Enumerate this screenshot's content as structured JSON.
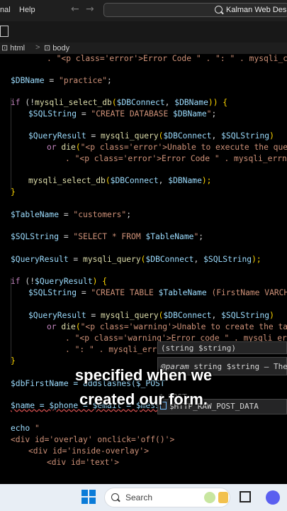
{
  "menubar": {
    "item_nal": "nal",
    "item_help": "Help",
    "back_icon": "arrow-left",
    "forward_icon": "arrow-right"
  },
  "search": {
    "text": "Kalman Web Design",
    "icon": "search-icon"
  },
  "breadcrumb": {
    "item1": "html",
    "item2": "body",
    "separator": ">"
  },
  "code": {
    "l01": ". \"<p class='error'>Error Code \" . \": \" . mysqli_conn",
    "l02a": "$DBName",
    "l02b": " = ",
    "l02c": "\"practice\"",
    "l02d": ";",
    "l03a": "if",
    "l03b": " (!",
    "l03c": "mysqli_select_db",
    "l03d": "(",
    "l03e": "$DBConnect",
    "l03f": ", ",
    "l03g": "$DBName",
    "l03h": ")) {",
    "l04a": "$SQLString",
    "l04b": " = ",
    "l04c": "\"CREATE DATABASE ",
    "l04d": "$DBName",
    "l04e": "\"",
    "l04f": ";",
    "l05a": "$QueryResult",
    "l05b": " = ",
    "l05c": "mysqli_query",
    "l05d": "(",
    "l05e": "$DBConnect",
    "l05f": ", ",
    "l05g": "$SQLString",
    "l05h": ")",
    "l06a": "or ",
    "l06b": "die",
    "l06c": "(",
    "l06d": "\"<p class='error'>Unable to execute the query.",
    "l07": ". \"<p class='error'>Error Code \" . mysqli_errno($",
    "l08a": "mysqli_select_db",
    "l08b": "(",
    "l08c": "$DBConnect",
    "l08d": ", ",
    "l08e": "$DBName",
    "l08f": ");",
    "l09": "}",
    "l10a": "$TableName",
    "l10b": " = ",
    "l10c": "\"customers\"",
    "l10d": ";",
    "l11a": "$SQLString",
    "l11b": " = ",
    "l11c": "\"SELECT * FROM ",
    "l11d": "$TableName",
    "l11e": "\"",
    "l11f": ";",
    "l12a": "$QueryResult",
    "l12b": " = ",
    "l12c": "mysqli_query",
    "l12d": "(",
    "l12e": "$DBConnect",
    "l12f": ", ",
    "l12g": "$SQLString",
    "l12h": ");",
    "l13a": "if",
    "l13b": " (!",
    "l13c": "$QueryResult",
    "l13d": ") {",
    "l14a": "$SQLString",
    "l14b": " = ",
    "l14c": "\"CREATE TABLE ",
    "l14d": "$TableName",
    "l14e": " (FirstName VARCHAR(",
    "l15a": "$QueryResult",
    "l15b": " = ",
    "l15c": "mysqli_query",
    "l15d": "(",
    "l15e": "$DBConnect",
    "l15f": ", ",
    "l15g": "$SQLString",
    "l15h": ")",
    "l16a": "or ",
    "l16b": "die",
    "l16c": "(",
    "l16d": "\"<p class='warning'>Unable to create the table",
    "l17": ". \"<p class='warning'>Error code \" . mysqli_errno(",
    "l18": ". \": \" . mysqli_erro",
    "l19": "}",
    "l20": "$dbFirstName = addslashes($_POST",
    "l21": "$name = $phone = $email = $messa",
    "l22a": "echo",
    "l22b": " \"",
    "l23a": "<div id='overlay' onclick='off()'>",
    "l24a": "<div id='inside-overlay'>",
    "l25a": "<div id='text'>"
  },
  "tooltip": {
    "sig": "(string $string)",
    "param_label": "@param",
    "param_type": " string ",
    "param_var": "$string",
    "param_rest": " — The"
  },
  "suggestion": {
    "icon": "variable-icon",
    "text": "$HTTP_RAW_POST_DATA",
    "faded": "$_POST"
  },
  "caption": {
    "line1": "specified when we",
    "line2": "created our form."
  },
  "taskbar": {
    "search_placeholder": "Search"
  }
}
